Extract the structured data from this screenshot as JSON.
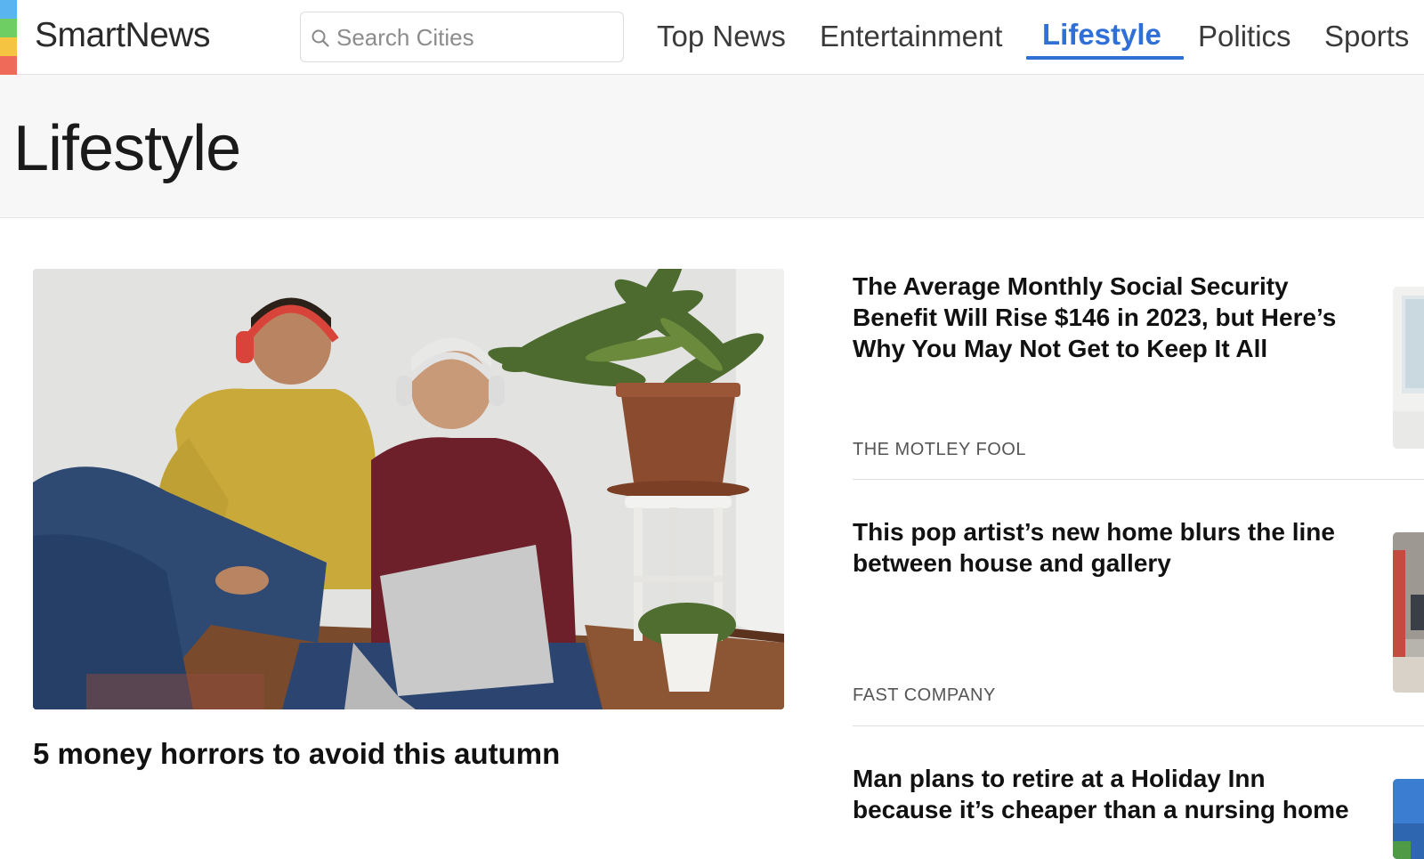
{
  "brand": {
    "name": "SmartNews",
    "stripe_colors": [
      "#5ab4f0",
      "#6fce63",
      "#f5c542",
      "#f06a5a"
    ]
  },
  "search": {
    "placeholder": "Search Cities",
    "value": ""
  },
  "nav": {
    "items": [
      {
        "label": "Top News",
        "active": false
      },
      {
        "label": "Entertainment",
        "active": false
      },
      {
        "label": "Lifestyle",
        "active": true
      },
      {
        "label": "Politics",
        "active": false
      },
      {
        "label": "Sports",
        "active": false
      }
    ],
    "active_color": "#2f6fd6"
  },
  "page": {
    "title": "Lifestyle"
  },
  "featured": {
    "title": "5 money horrors to avoid this autumn"
  },
  "articles": [
    {
      "title": "The Average Monthly Social Security Benefit Will Rise $146 in 2023, but Here’s Why You May Not Get to Keep It All",
      "source": "THE MOTLEY FOOL"
    },
    {
      "title": "This pop artist’s new home blurs the line between house and gallery",
      "source": "FAST COMPANY"
    },
    {
      "title": "Man plans to retire at a Holiday Inn because it’s cheaper than a nursing home",
      "source": ""
    }
  ]
}
